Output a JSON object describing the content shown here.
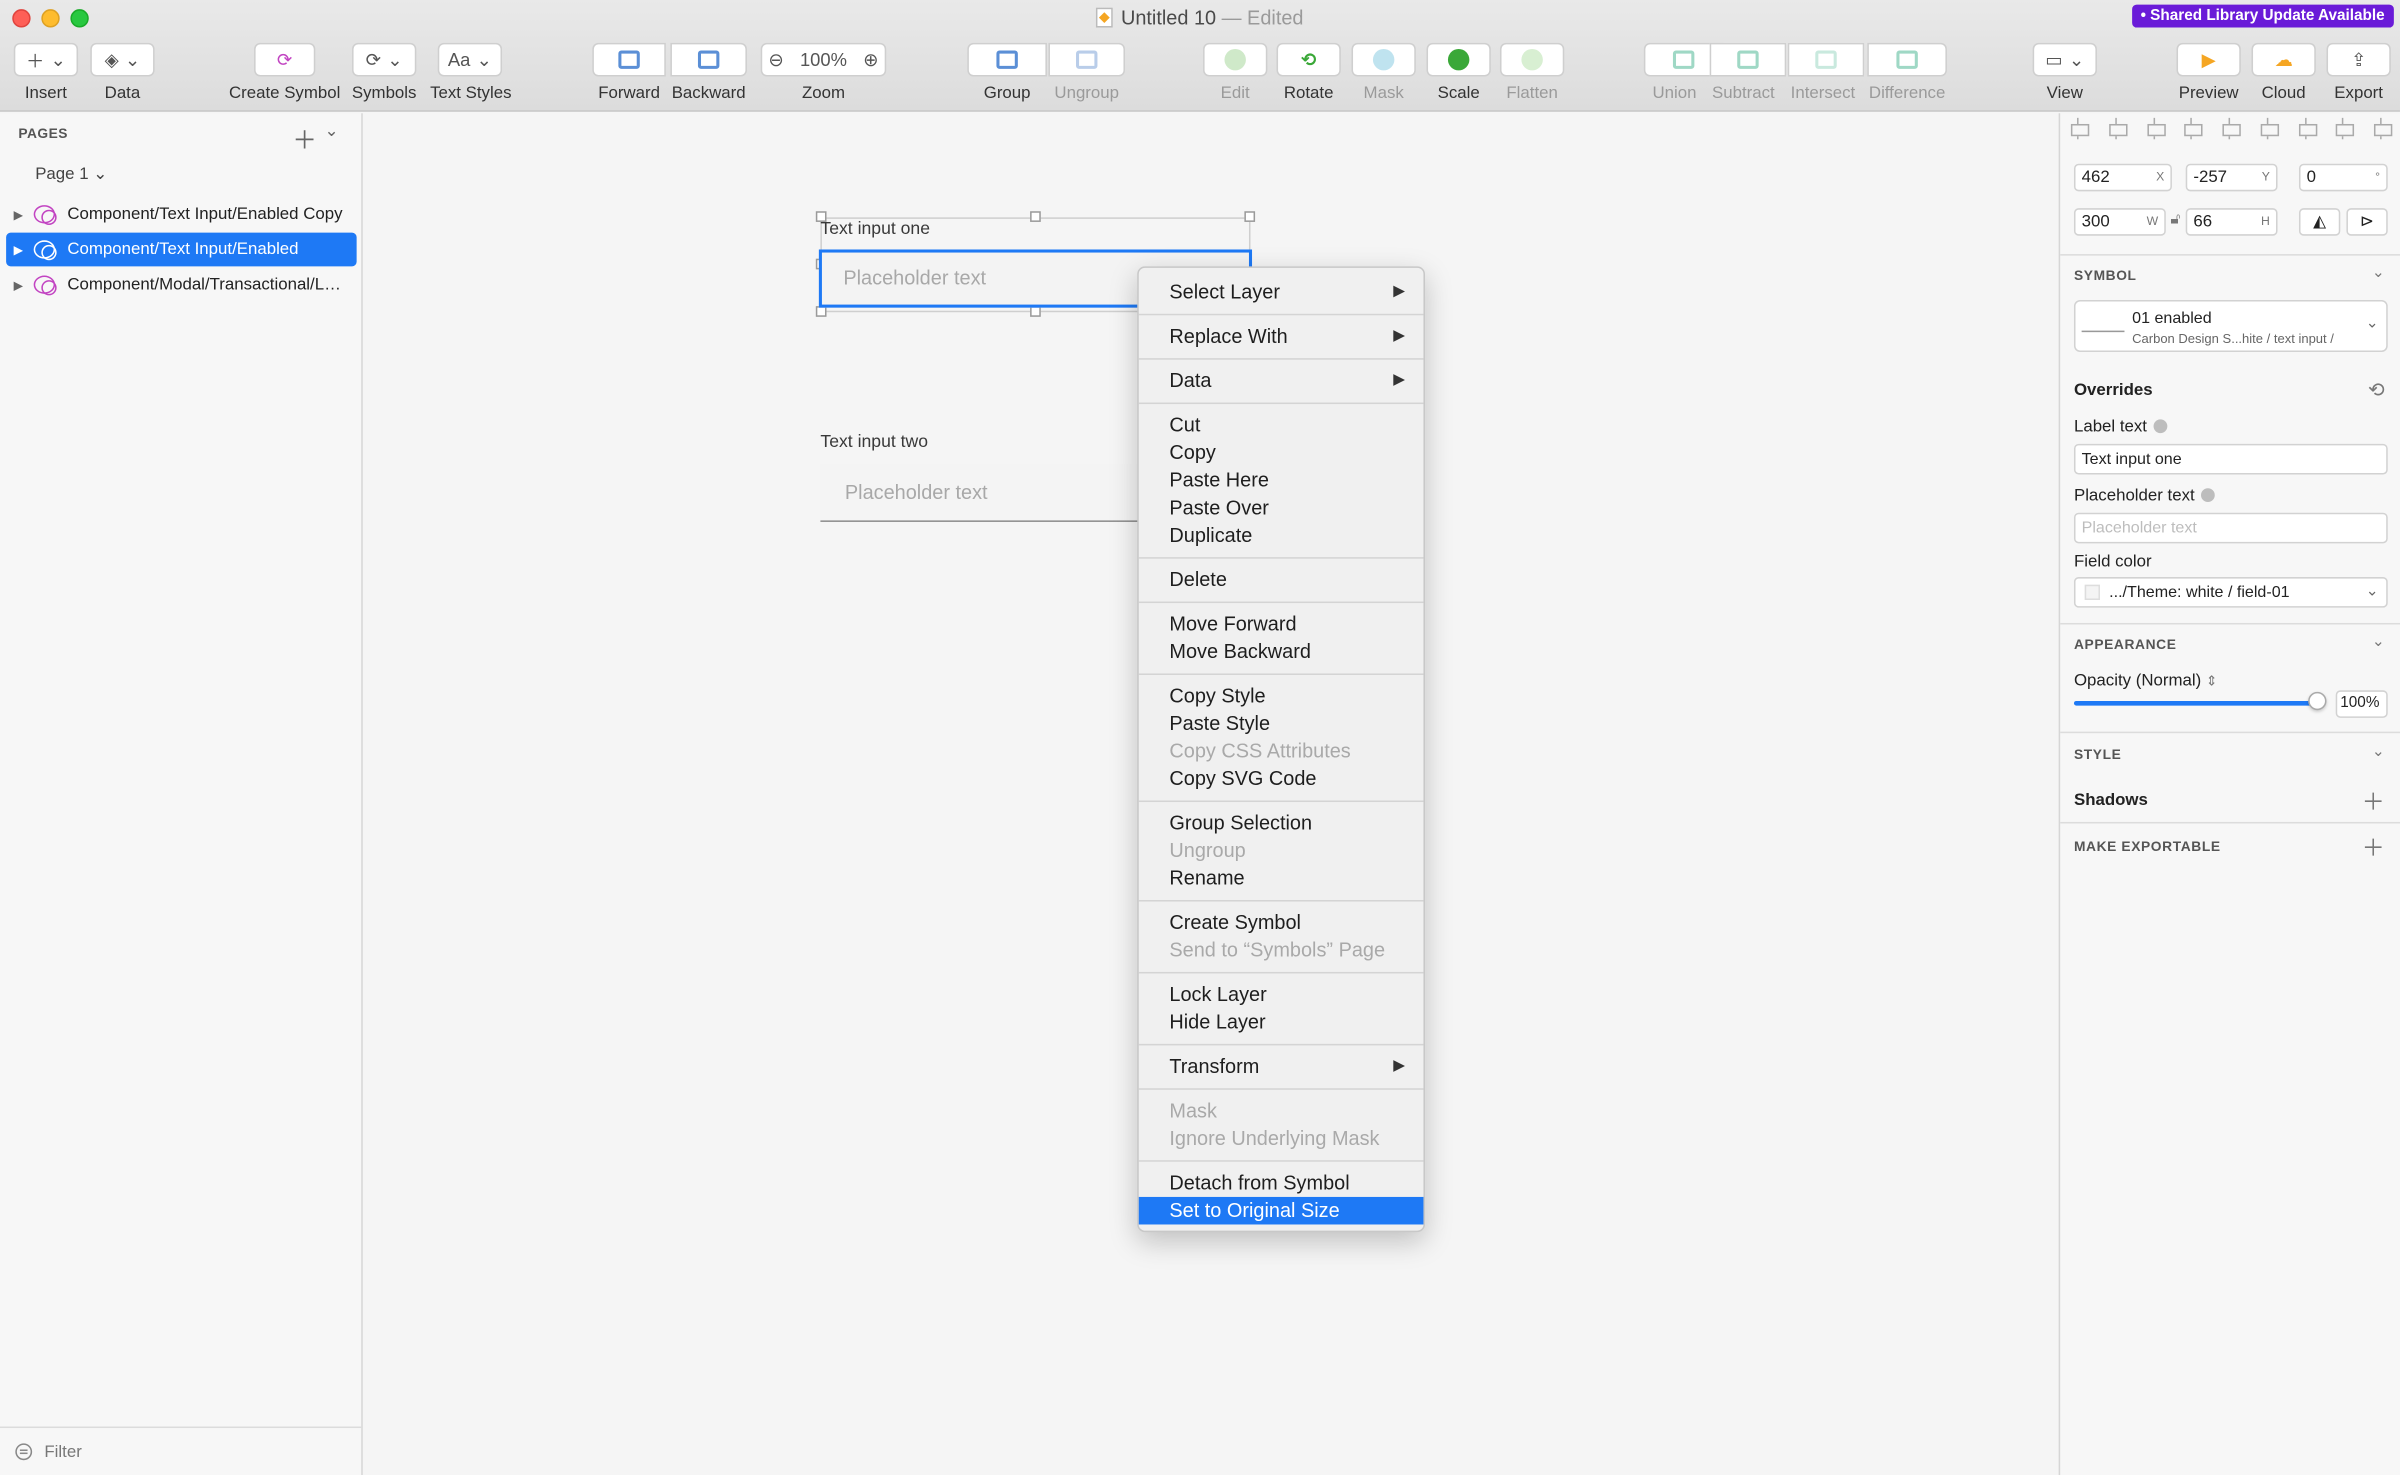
{
  "window": {
    "title": "Untitled 10",
    "title_status": "— Edited",
    "shared_badge": "• Shared Library Update Available"
  },
  "toolbar": {
    "insert": "Insert",
    "data": "Data",
    "create_symbol": "Create Symbol",
    "symbols": "Symbols",
    "text_styles": "Text Styles",
    "text_styles_glyph": "Aa",
    "forward": "Forward",
    "backward": "Backward",
    "zoom": "Zoom",
    "zoom_value": "100%",
    "group": "Group",
    "ungroup": "Ungroup",
    "edit": "Edit",
    "rotate": "Rotate",
    "mask": "Mask",
    "scale": "Scale",
    "flatten": "Flatten",
    "union": "Union",
    "subtract": "Subtract",
    "intersect": "Intersect",
    "difference": "Difference",
    "view": "View",
    "preview": "Preview",
    "cloud": "Cloud",
    "export": "Export"
  },
  "left_panel": {
    "pages_header": "PAGES",
    "page_selector": "Page 1",
    "layers": [
      {
        "label": "Component/Text Input/Enabled Copy"
      },
      {
        "label": "Component/Text Input/Enabled"
      },
      {
        "label": "Component/Modal/Transactional/Large/Default"
      }
    ],
    "filter": "Filter"
  },
  "canvas": {
    "input_one_label": "Text input one",
    "input_one_placeholder": "Placeholder text",
    "input_two_label": "Text input two",
    "input_two_placeholder": "Placeholder text"
  },
  "context_menu": {
    "items": [
      "Select Layer",
      "Replace With",
      "Data",
      "Cut",
      "Copy",
      "Paste Here",
      "Paste Over",
      "Duplicate",
      "Delete",
      "Move Forward",
      "Move Backward",
      "Copy Style",
      "Paste Style",
      "Copy CSS Attributes",
      "Copy SVG Code",
      "Group Selection",
      "Ungroup",
      "Rename",
      "Create Symbol",
      "Send to “Symbols” Page",
      "Lock Layer",
      "Hide Layer",
      "Transform",
      "Mask",
      "Ignore Underlying Mask",
      "Detach from Symbol",
      "Set to Original Size"
    ]
  },
  "inspector": {
    "x": "462",
    "x_suffix": "X",
    "y": "-257",
    "y_suffix": "Y",
    "rotation": "0",
    "rotation_suffix": "°",
    "w": "300",
    "w_suffix": "W",
    "h": "66",
    "h_suffix": "H",
    "symbol_header": "SYMBOL",
    "symbol_name": "01 enabled",
    "symbol_path": "Carbon Design S...hite / text input /",
    "overrides": "Overrides",
    "label_text_lbl": "Label text",
    "label_text_val": "Text input one",
    "placeholder_text_lbl": "Placeholder text",
    "placeholder_text_val": "Placeholder text",
    "field_color_lbl": "Field color",
    "field_color_val": ".../Theme: white / field-01",
    "appearance_header": "APPEARANCE",
    "opacity_lbl": "Opacity (Normal)",
    "opacity_val": "100%",
    "style_header": "STYLE",
    "shadows_lbl": "Shadows",
    "exportable_header": "MAKE EXPORTABLE"
  },
  "colors": {
    "accent": "#1e79f5",
    "badge": "#6a1bd8",
    "symbol_icon": "#c244c2"
  }
}
